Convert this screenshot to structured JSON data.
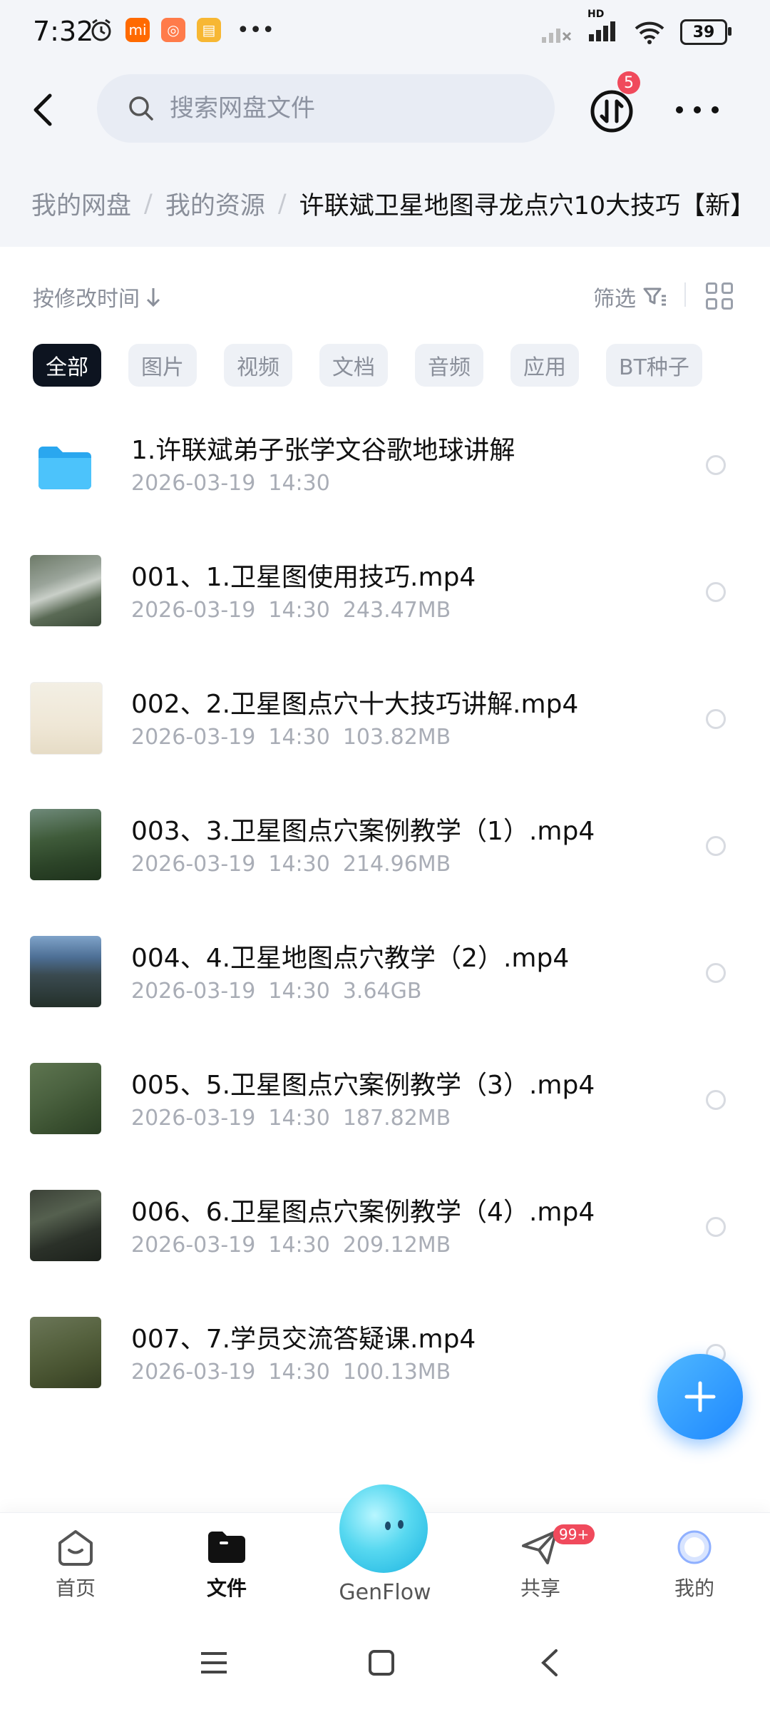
{
  "status_bar": {
    "time": "7:32",
    "battery": "39",
    "network": "HD"
  },
  "header": {
    "search_placeholder": "搜索网盘文件",
    "transfer_badge": "5"
  },
  "breadcrumb": {
    "items": [
      "我的网盘",
      "我的资源"
    ],
    "current": "许联斌卫星地图寻龙点穴10大技巧【新】"
  },
  "toolbar": {
    "sort_label": "按修改时间",
    "filter_label": "筛选"
  },
  "filter_chips": [
    "全部",
    "图片",
    "视频",
    "文档",
    "音频",
    "应用",
    "BT种子"
  ],
  "files": [
    {
      "name": "1.许联斌弟子张学文谷歌地球讲解",
      "date": "2026-03-19",
      "time": "14:30",
      "size": "",
      "type": "folder"
    },
    {
      "name": "001、1.卫星图使用技巧.mp4",
      "date": "2026-03-19",
      "time": "14:30",
      "size": "243.47MB",
      "type": "video"
    },
    {
      "name": "002、2.卫星图点穴十大技巧讲解.mp4",
      "date": "2026-03-19",
      "time": "14:30",
      "size": "103.82MB",
      "type": "video"
    },
    {
      "name": "003、3.卫星图点穴案例教学（1）.mp4",
      "date": "2026-03-19",
      "time": "14:30",
      "size": "214.96MB",
      "type": "video"
    },
    {
      "name": "004、4.卫星地图点穴教学（2）.mp4",
      "date": "2026-03-19",
      "time": "14:30",
      "size": "3.64GB",
      "type": "video"
    },
    {
      "name": "005、5.卫星图点穴案例教学（3）.mp4",
      "date": "2026-03-19",
      "time": "14:30",
      "size": "187.82MB",
      "type": "video"
    },
    {
      "name": "006、6.卫星图点穴案例教学（4）.mp4",
      "date": "2026-03-19",
      "time": "14:30",
      "size": "209.12MB",
      "type": "video"
    },
    {
      "name": "007、7.学员交流答疑课.mp4",
      "date": "2026-03-19",
      "time": "14:30",
      "size": "100.13MB",
      "type": "video"
    }
  ],
  "bottom_nav": {
    "home": "首页",
    "files": "文件",
    "genflow": "GenFlow",
    "share": "共享",
    "share_badge": "99+",
    "me": "我的"
  },
  "colors": {
    "accent": "#1e88ff",
    "badge": "#f04a5c",
    "folder": "#39b6f5",
    "chip_active": "#0d1420"
  }
}
